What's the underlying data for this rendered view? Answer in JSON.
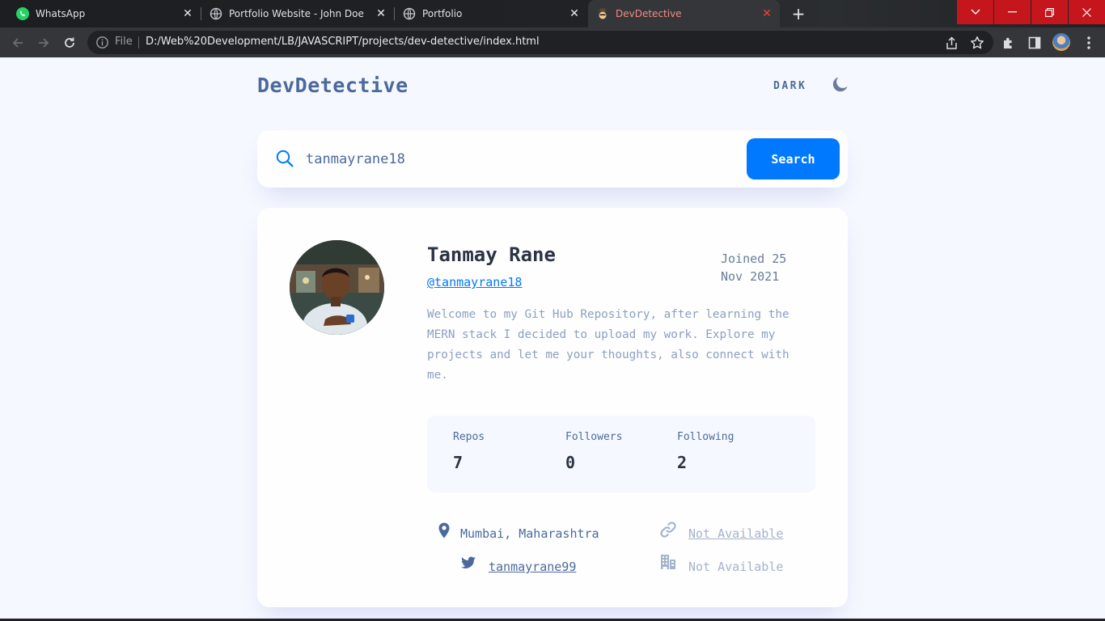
{
  "browser": {
    "tabs": [
      {
        "title": "WhatsApp",
        "icon": "whatsapp-icon"
      },
      {
        "title": "Portfolio Website - John Doe",
        "icon": "globe-icon"
      },
      {
        "title": "Portfolio",
        "icon": "globe-icon"
      },
      {
        "title": "DevDetective",
        "icon": "detective-icon",
        "active": true
      }
    ],
    "address": {
      "scheme_label": "File",
      "url": "D:/Web%20Development/LB/JAVASCRIPT/projects/dev-detective/index.html"
    },
    "accent_colors": {
      "window_controls": "#c4161c",
      "active_tab_text": "#f28b82"
    }
  },
  "app": {
    "logo": "DevDetective",
    "theme_toggle_label": "DARK",
    "theme_icon": "moon-icon"
  },
  "search": {
    "value": "tanmayrane18",
    "button_label": "Search",
    "icon": "search-icon",
    "accent": "#0079ff"
  },
  "profile": {
    "name": "Tanmay Rane",
    "handle": "@tanmayrane18",
    "joined_line1": "Joined 25",
    "joined_line2": "Nov 2021",
    "bio": "Welcome to my Git Hub Repository, after learning the MERN stack I decided to upload my work. Explore my projects and let me your thoughts, also connect with me.",
    "stats": {
      "repos_label": "Repos",
      "repos": "7",
      "followers_label": "Followers",
      "followers": "0",
      "following_label": "Following",
      "following": "2"
    },
    "links": {
      "location": "Mumbai, Maharashtra",
      "website": "Not Available",
      "twitter": "tanmayrane99",
      "company": "Not Available"
    }
  }
}
